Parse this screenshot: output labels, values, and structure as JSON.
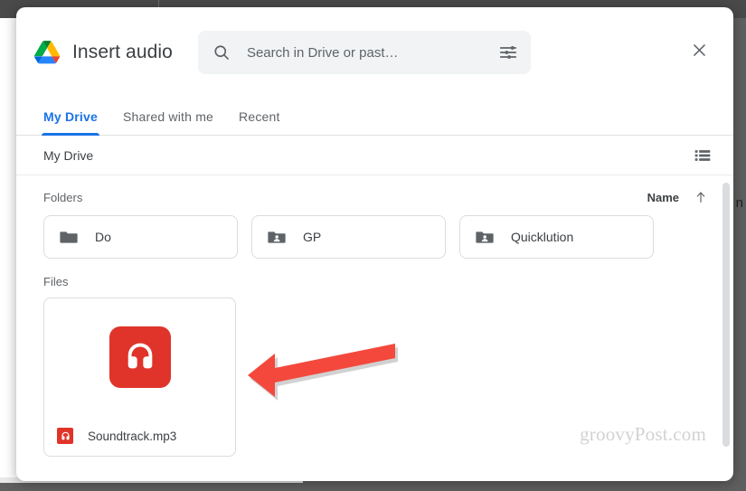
{
  "dialog": {
    "title": "Insert audio",
    "logo_icon": "google-drive-logo",
    "close_icon": "close-icon",
    "close_label": "Close"
  },
  "search": {
    "placeholder": "Search in Drive or past…",
    "value": "",
    "search_icon": "search-icon",
    "filter_icon": "tune-icon"
  },
  "tabs": [
    {
      "label": "My Drive",
      "active": true
    },
    {
      "label": "Shared with me",
      "active": false
    },
    {
      "label": "Recent",
      "active": false
    }
  ],
  "breadcrumb": {
    "path": "My Drive",
    "view_toggle_icon": "list-view-icon"
  },
  "sections": {
    "folders_label": "Folders",
    "files_label": "Files"
  },
  "sort": {
    "label": "Name",
    "direction_icon": "arrow-up-icon",
    "direction": "ascending"
  },
  "folders": [
    {
      "name": "Do",
      "icon": "folder-icon",
      "shared": false
    },
    {
      "name": "GP",
      "icon": "shared-folder-icon",
      "shared": true
    },
    {
      "name": "Quicklution",
      "icon": "shared-folder-icon",
      "shared": true
    }
  ],
  "files": [
    {
      "name": "Soundtrack.mp3",
      "icon": "audio-file-icon",
      "thumb_icon": "headphones-icon",
      "color": "#e0342a"
    }
  ],
  "watermark": {
    "text": "groovyPost.com"
  },
  "annotation": {
    "arrow_color": "#f4483c",
    "arrow_direction": "left"
  },
  "background": {
    "partial_char": "n"
  },
  "colors": {
    "accent_blue": "#1a73e8",
    "audio_red": "#e0342a",
    "text_primary": "#3c4043",
    "text_secondary": "#5f6368",
    "border": "#dadce0",
    "search_bg": "#f1f3f4"
  }
}
